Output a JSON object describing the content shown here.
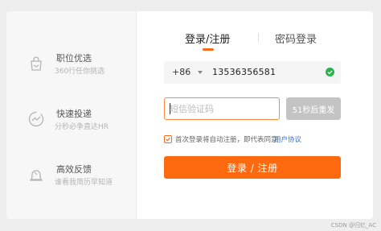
{
  "sidebar": {
    "features": [
      {
        "icon": "bag-icon",
        "title": "职位优选",
        "subtitle": "360行任你挑选"
      },
      {
        "icon": "trend-icon",
        "title": "快速投递",
        "subtitle": "分秒必争直达HR"
      },
      {
        "icon": "bell-icon",
        "title": "高效反馈",
        "subtitle": "谁看我简历早知道"
      }
    ]
  },
  "tabs": {
    "login": "登录/注册",
    "code": "密码登录"
  },
  "phone": {
    "country_code": "+86",
    "number": "13536356581",
    "valid_icon": "check-circle-icon"
  },
  "code": {
    "placeholder": "短信验证码",
    "resend_label": "51秒后重发"
  },
  "agreement": {
    "text": "首次登录将自动注册，即代表同意",
    "link": "用户协议",
    "checked": true
  },
  "submit_label": "登录 / 注册",
  "watermark": "CSDN @归忆_AC",
  "colors": {
    "accent": "#ff6a10",
    "link": "#3a6fc4",
    "valid": "#2bb24c"
  }
}
